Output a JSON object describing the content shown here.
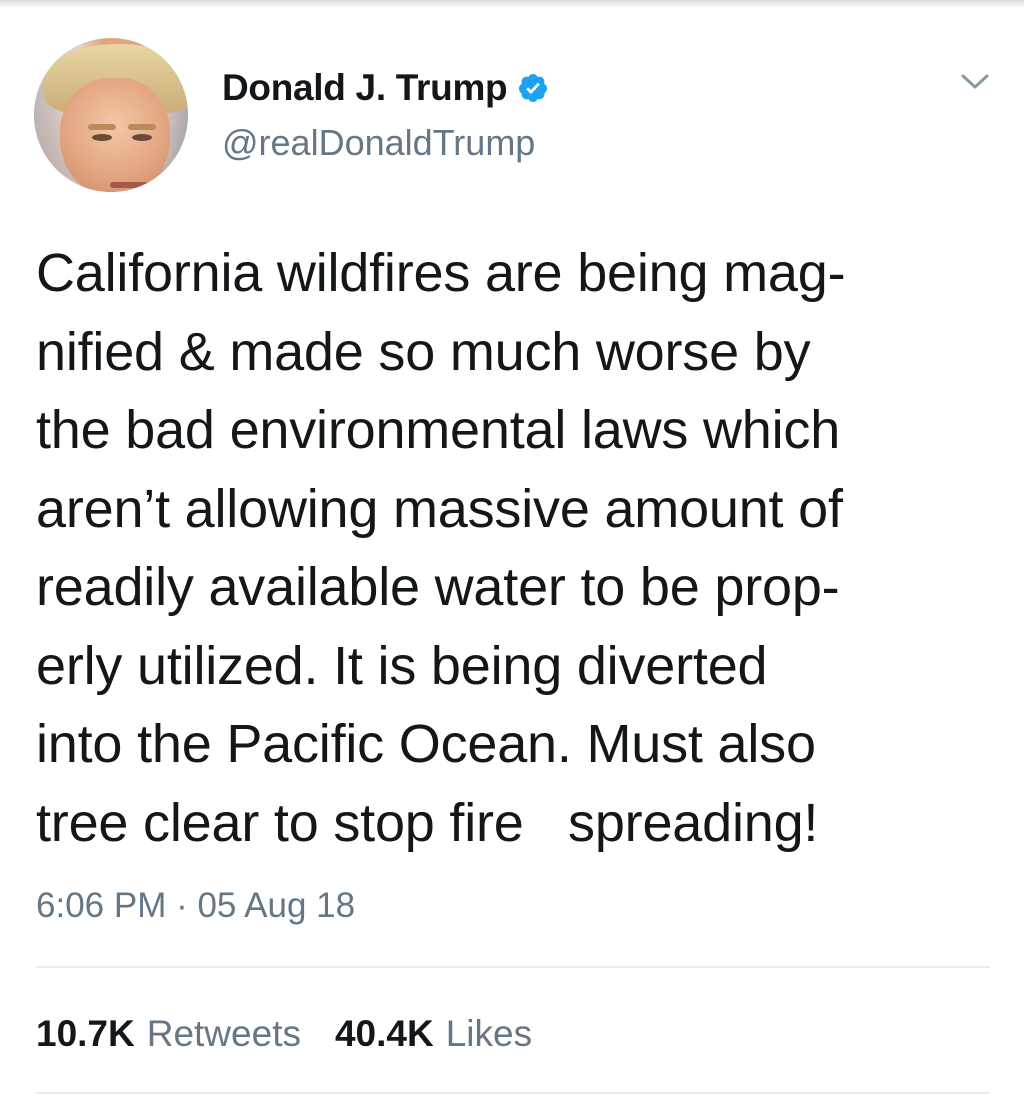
{
  "user": {
    "display_name": "Donald J. Trump",
    "handle": "@realDonaldTrump",
    "verified": true,
    "avatar_icon": "profile-photo"
  },
  "tweet": {
    "lines": [
      "California wildfires are being mag-",
      "nified & made so much worse by",
      "the bad environmental laws which",
      "aren’t allowing massive amount of",
      "readily available water to be prop-",
      "erly utilized. It is being diverted",
      "into the Pacific Ocean. Must also",
      "tree clear to stop fire   spreading!"
    ],
    "timestamp": "6:06 PM · 05 Aug 18"
  },
  "stats": {
    "retweets_count": "10.7K",
    "retweets_label": "Retweets",
    "likes_count": "40.4K",
    "likes_label": "Likes"
  },
  "icons": {
    "verified": "verified-badge-icon",
    "menu": "chevron-down-icon"
  },
  "colors": {
    "verified_blue": "#1da1f2",
    "text_primary": "#14171a",
    "text_secondary": "#657786",
    "divider": "#e6ecf0"
  }
}
